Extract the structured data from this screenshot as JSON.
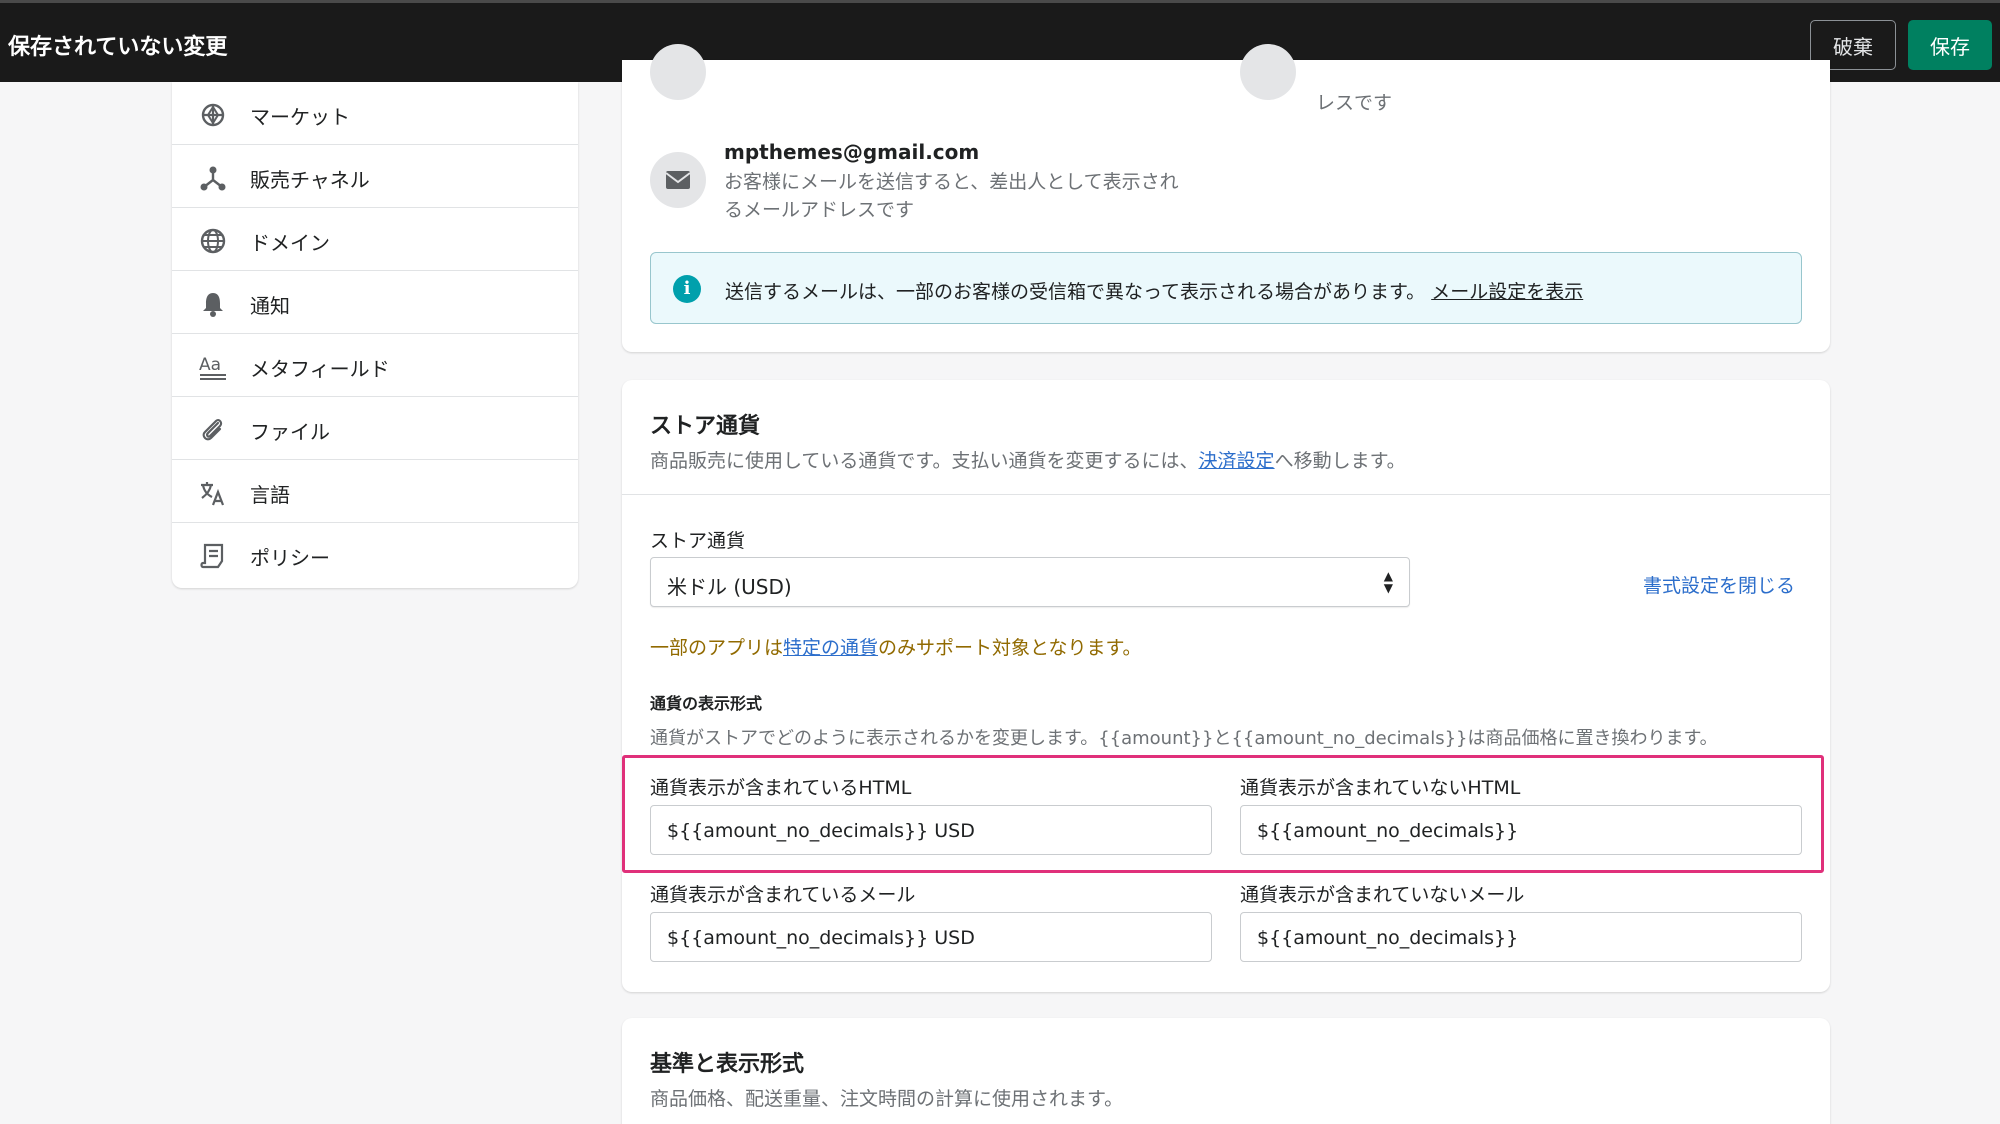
{
  "topbar": {
    "title": "保存されていない変更",
    "discard_label": "破棄",
    "save_label": "保存",
    "save_color": "#008060"
  },
  "sidebar": {
    "items": [
      {
        "label": "マーケット",
        "icon": "globe-icon"
      },
      {
        "label": "販売チャネル",
        "icon": "channels-icon"
      },
      {
        "label": "ドメイン",
        "icon": "domain-globe-icon"
      },
      {
        "label": "通知",
        "icon": "bell-icon"
      },
      {
        "label": "メタフィールド",
        "icon": "metafields-icon"
      },
      {
        "label": "ファイル",
        "icon": "paperclip-icon"
      },
      {
        "label": "言語",
        "icon": "translate-icon"
      },
      {
        "label": "ポリシー",
        "icon": "policy-icon"
      }
    ]
  },
  "contact": {
    "partial_text": "レスです",
    "sender_email": "mpthemes@gmail.com",
    "sender_desc_line1": "お客様にメールを送信すると、差出人として表示され",
    "sender_desc_line2": "るメールアドレスです",
    "banner_text": "送信するメールは、一部のお客様の受信箱で異なって表示される場合があります。",
    "banner_link": "メール設定を表示"
  },
  "currency": {
    "heading": "ストア通貨",
    "desc_before": "商品販売に使用している通貨です。支払い通貨を変更するには、",
    "desc_link": "決済設定",
    "desc_after": "へ移動します。",
    "select_label": "ストア通貨",
    "select_value": "米ドル (USD)",
    "close_format_link": "書式設定を閉じる",
    "warning_before": "一部のアプリは",
    "warning_link": "特定の通貨",
    "warning_after": "のみサポート対象となります。",
    "format_heading": "通貨の表示形式",
    "format_desc": "通貨がストアでどのように表示されるかを変更します。{{amount}}と{{amount_no_decimals}}は商品価格に置き換わります。",
    "fields": {
      "html_with_label": "通貨表示が含まれているHTML",
      "html_with_value": "${{amount_no_decimals}} USD",
      "html_without_label": "通貨表示が含まれていないHTML",
      "html_without_value": "${{amount_no_decimals}}",
      "email_with_label": "通貨表示が含まれているメール",
      "email_with_value": "${{amount_no_decimals}} USD",
      "email_without_label": "通貨表示が含まれていないメール",
      "email_without_value": "${{amount_no_decimals}}"
    },
    "highlight_color": "#e0307a"
  },
  "standards": {
    "heading": "基準と表示形式",
    "desc": "商品価格、配送重量、注文時間の計算に使用されます。"
  }
}
